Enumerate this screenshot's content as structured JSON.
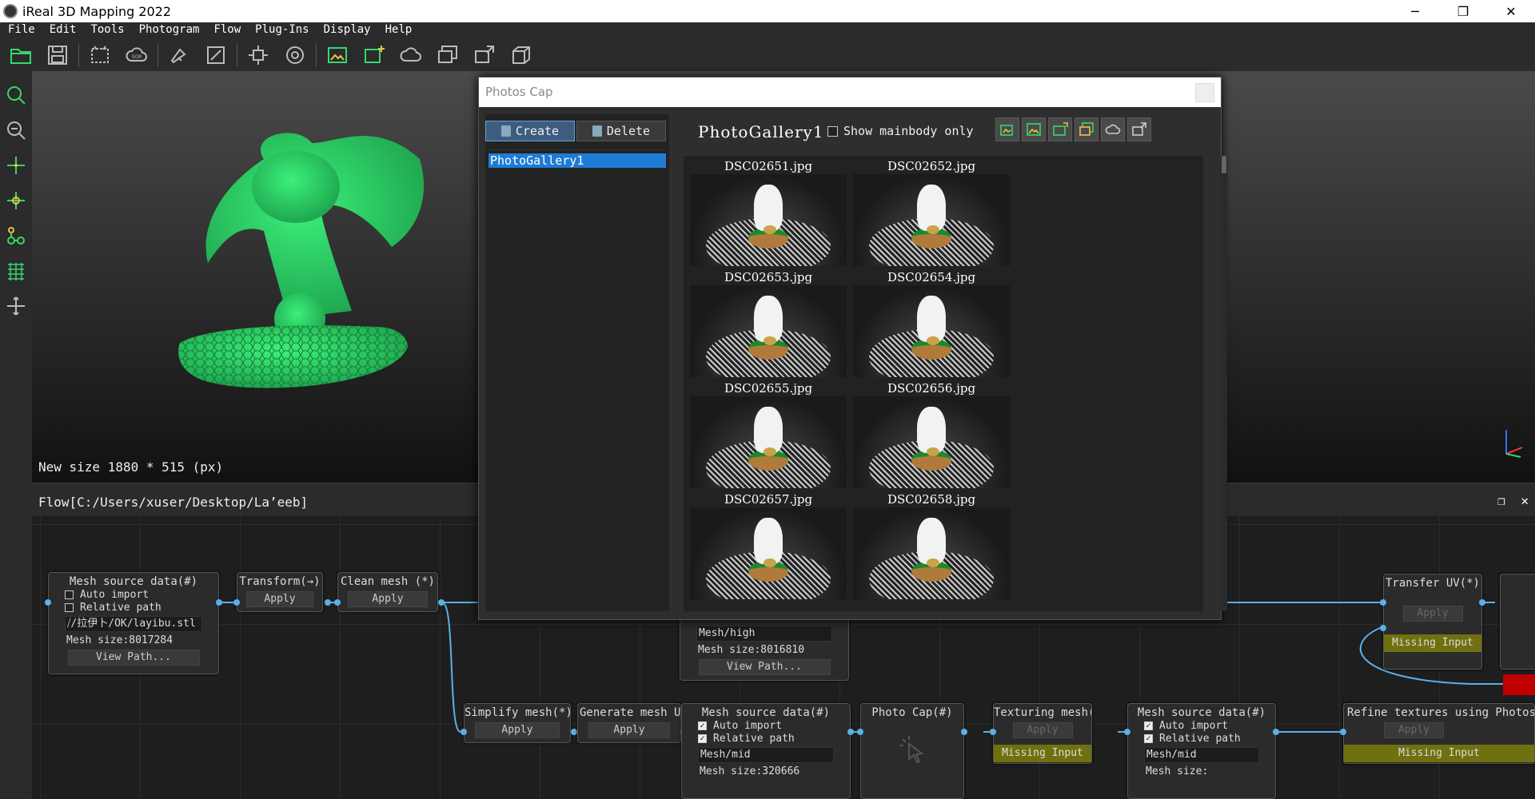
{
  "app": {
    "title": "iReal 3D Mapping 2022"
  },
  "window_controls": {
    "minimize": "─",
    "maximize": "❐",
    "close": "✕"
  },
  "menu": [
    "File",
    "Edit",
    "Tools",
    "Photogram",
    "Flow",
    "Plug-Ins",
    "Display",
    "Help"
  ],
  "toolbar_icons": [
    "open-folder-icon",
    "save-icon",
    "select-region-icon",
    "sor-cloud-icon",
    "paint-icon",
    "edit-mesh-icon",
    "transform-icon",
    "target-icon",
    "photo-gallery-icon",
    "add-photo-icon",
    "cloud-icon",
    "photo-stack-icon",
    "photo-sync-icon",
    "texture-box-icon"
  ],
  "side_tools": [
    "zoom-icon",
    "zoom-fit-icon",
    "axis-cross-icon",
    "axis-center-icon",
    "node-graph-icon",
    "grid-icon",
    "move-icon"
  ],
  "viewport": {
    "status": "New size 1880 * 515 (px)",
    "model_color": "#33d96b"
  },
  "flow": {
    "title": "Flow[C:/Users/xuser/Desktop/La’eeb]",
    "panel_controls": {
      "float": "❐",
      "close": "✕"
    },
    "nodes": {
      "mesh_source_1": {
        "title": "Mesh source data(#)",
        "auto_import": "Auto import",
        "relative_path": "Relative path",
        "path": "⧸/拉伊卜/OK/layibu.stl",
        "size": "Mesh size:8017284",
        "view_path": "View Path..."
      },
      "transform": {
        "title": "Transform(→)",
        "apply": "Apply"
      },
      "clean_mesh": {
        "title": "Clean mesh (*)",
        "apply": "Apply"
      },
      "mesh_high": {
        "path": "Mesh/high",
        "size": "Mesh size:8016810",
        "view_path": "View Path..."
      },
      "transfer_uv": {
        "title": "Transfer UV(*)",
        "apply": "Apply",
        "missing": "Missing Input"
      },
      "simplify_mesh": {
        "title": "Simplify mesh(*)",
        "apply": "Apply"
      },
      "generate_mesh_uv": {
        "title": "Generate mesh UV(*)",
        "apply": "Apply"
      },
      "mesh_source_mid": {
        "title": "Mesh source data(#)",
        "auto_import": "Auto import",
        "relative_path": "Relative path",
        "path": "Mesh/mid",
        "size": "Mesh size:320666"
      },
      "photo_cap": {
        "title": "Photo Cap(#)"
      },
      "texturing_mesh": {
        "title": "Texturing mesh(*)",
        "apply": "Apply",
        "missing": "Missing Input"
      },
      "mesh_source_3": {
        "title": "Mesh source data(#)",
        "auto_import": "Auto import",
        "relative_path": "Relative path",
        "path": "Mesh/mid",
        "size": "Mesh size:"
      },
      "refine_textures": {
        "title": "Refine textures using Photos",
        "apply": "Apply",
        "missing": "Missing Input"
      }
    }
  },
  "dialog": {
    "title": "Photos Cap",
    "create": "Create",
    "delete": "Delete",
    "galleries": [
      "PhotoGallery1"
    ],
    "selected_gallery": "PhotoGallery1",
    "show_mainbody": "Show mainbody only",
    "tool_icons": [
      "add-photo-icon",
      "photo-gallery-icon",
      "camera-sync-icon",
      "photo-refresh-icon",
      "cloud-icon",
      "photo-settings-icon"
    ],
    "photos": [
      "DSC02651.jpg",
      "DSC02652.jpg",
      "DSC02653.jpg",
      "DSC02654.jpg",
      "DSC02655.jpg",
      "DSC02656.jpg",
      "DSC02657.jpg",
      "DSC02658.jpg"
    ]
  },
  "colors": {
    "accent_green": "#33d96b",
    "wire_blue": "#5ab0e8",
    "selection_blue": "#1e7cd6",
    "missing_input": "#707010"
  }
}
